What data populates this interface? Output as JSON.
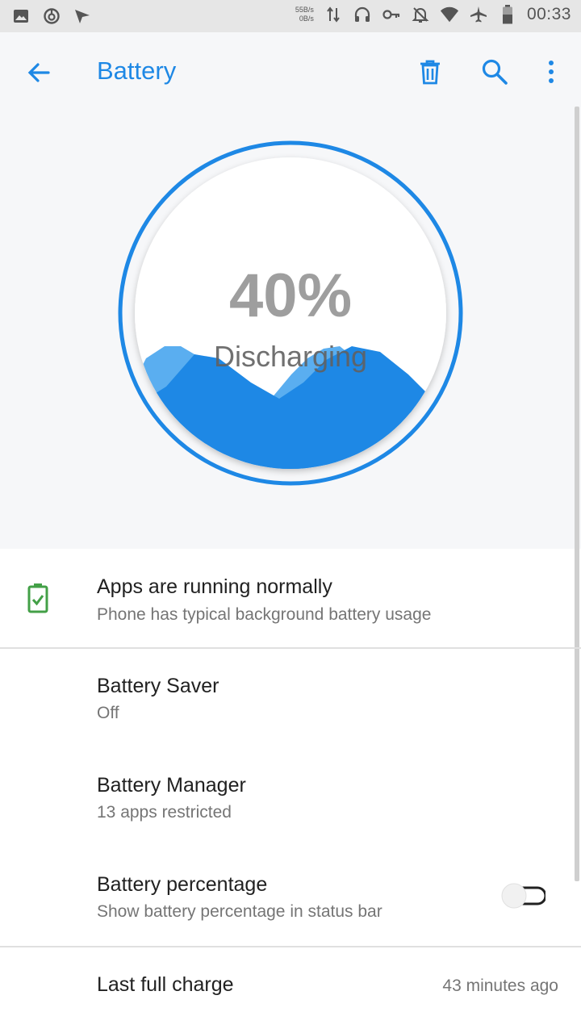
{
  "status_bar": {
    "icons_left": [
      "image-icon",
      "sync-icon",
      "send-icon"
    ],
    "net_up": "55B/s",
    "net_down": "0B/s",
    "battery_level": "40",
    "time": "00:33"
  },
  "appbar": {
    "title": "Battery"
  },
  "gauge": {
    "percent_text": "40%",
    "status": "Discharging",
    "level": 0.4
  },
  "list": {
    "health": {
      "title": "Apps are running normally",
      "subtitle": "Phone has typical background battery usage"
    },
    "saver": {
      "title": "Battery Saver",
      "subtitle": "Off"
    },
    "manager": {
      "title": "Battery Manager",
      "subtitle": "13 apps restricted"
    },
    "percentage": {
      "title": "Battery percentage",
      "subtitle": "Show battery percentage in status bar",
      "enabled": false
    },
    "last_charge": {
      "title": "Last full charge",
      "value": "43 minutes ago"
    }
  },
  "colors": {
    "accent": "#1e88e5",
    "wave_light": "#5aaef0",
    "ok_green": "#43a047"
  }
}
